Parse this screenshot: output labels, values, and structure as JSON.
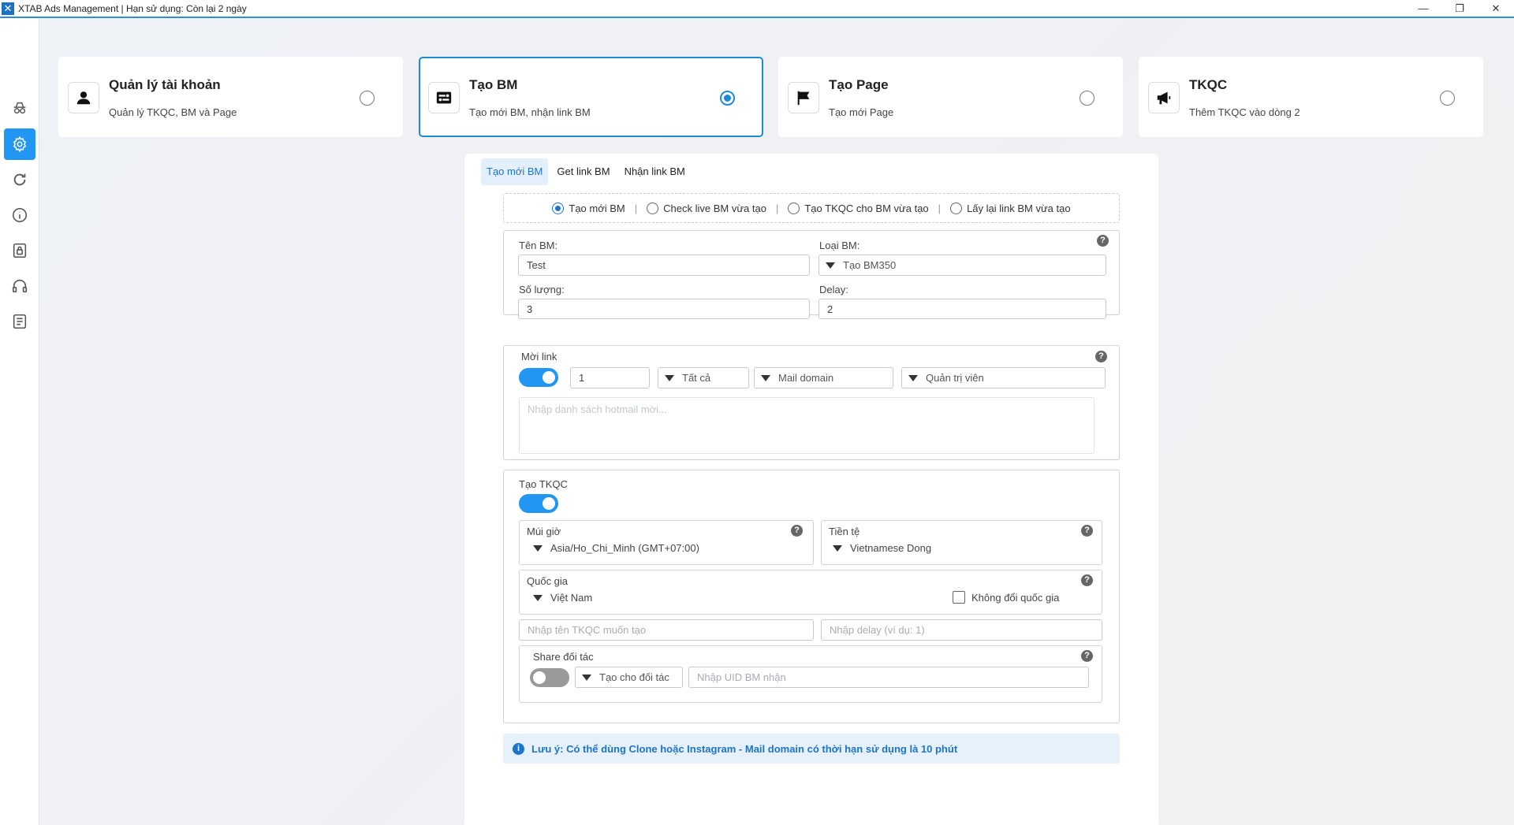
{
  "window": {
    "title": "XTAB Ads Management | Hạn sử dụng: Còn lại 2 ngày",
    "controls": {
      "minimize": "—",
      "restore": "❐",
      "close": "✕"
    }
  },
  "sidebar": {
    "items": [
      {
        "name": "incognito-icon",
        "active": false
      },
      {
        "name": "settings-icon",
        "active": true
      },
      {
        "name": "refresh-icon",
        "active": false
      },
      {
        "name": "info-icon",
        "active": false
      },
      {
        "name": "lock-icon",
        "active": false
      },
      {
        "name": "headset-icon",
        "active": false
      },
      {
        "name": "document-icon",
        "active": false
      }
    ]
  },
  "cards": [
    {
      "title": "Quản lý tài khoản",
      "subtitle": "Quản lý TKQC, BM và Page",
      "icon": "user-icon",
      "selected": false
    },
    {
      "title": "Tạo BM",
      "subtitle": "Tạo mới BM, nhận link BM",
      "icon": "bm-icon",
      "selected": true
    },
    {
      "title": "Tạo Page",
      "subtitle": "Tạo mới Page",
      "icon": "flag-icon",
      "selected": false
    },
    {
      "title": "TKQC",
      "subtitle": "Thêm TKQC vào dòng 2",
      "icon": "megaphone-icon",
      "selected": false
    }
  ],
  "tabs": [
    {
      "label": "Tạo mới BM",
      "active": true
    },
    {
      "label": "Get link BM",
      "active": false
    },
    {
      "label": "Nhận link BM",
      "active": false
    }
  ],
  "modes": [
    {
      "label": "Tạo mới BM",
      "selected": true
    },
    {
      "label": "Check live BM vừa tạo",
      "selected": false
    },
    {
      "label": "Tạo TKQC cho BM vừa tạo",
      "selected": false
    },
    {
      "label": "Lấy lại link BM vừa tạo",
      "selected": false
    }
  ],
  "mode_separator": "|",
  "help_glyph": "?",
  "bm_settings": {
    "name_label": "Tên BM:",
    "name_value": "Test",
    "type_label": "Loại BM:",
    "type_value": "Tạo BM350",
    "quantity_label": "Số lượng:",
    "quantity_value": "3",
    "delay_label": "Delay:",
    "delay_value": "2"
  },
  "invite": {
    "label": "Mời link",
    "enabled": true,
    "count_value": "1",
    "filter_value": "Tất cả",
    "mail_domain_value": "Mail domain",
    "role_value": "Quản trị viên",
    "textarea_placeholder": "Nhập danh sách hotmail mời..."
  },
  "ad_account": {
    "label": "Tạo TKQC",
    "enabled": true,
    "timezone_label": "Múi giờ",
    "timezone_value": "Asia/Ho_Chi_Minh (GMT+07:00)",
    "currency_label": "Tiền tệ",
    "currency_value": "Vietnamese Dong",
    "country_label": "Quốc gia",
    "country_value": "Việt Nam",
    "keep_country_label": "Không đổi quốc gia",
    "keep_country_checked": false,
    "name_placeholder": "Nhập tên TKQC muốn tạo",
    "delay_placeholder": "Nhập delay (ví dụ: 1)",
    "share": {
      "label": "Share đối tác",
      "enabled": false,
      "partner_mode_value": "Tạo cho đối tác",
      "uid_placeholder": "Nhập UID BM nhận"
    }
  },
  "note": {
    "icon": "i",
    "text": "Lưu ý: Có thể dùng Clone hoặc Instagram - Mail domain có thời hạn sử dụng là 10 phút"
  },
  "colors": {
    "accent": "#2196f3",
    "selected_border": "#1d8ad6",
    "note_bg": "#e6f1fb"
  }
}
